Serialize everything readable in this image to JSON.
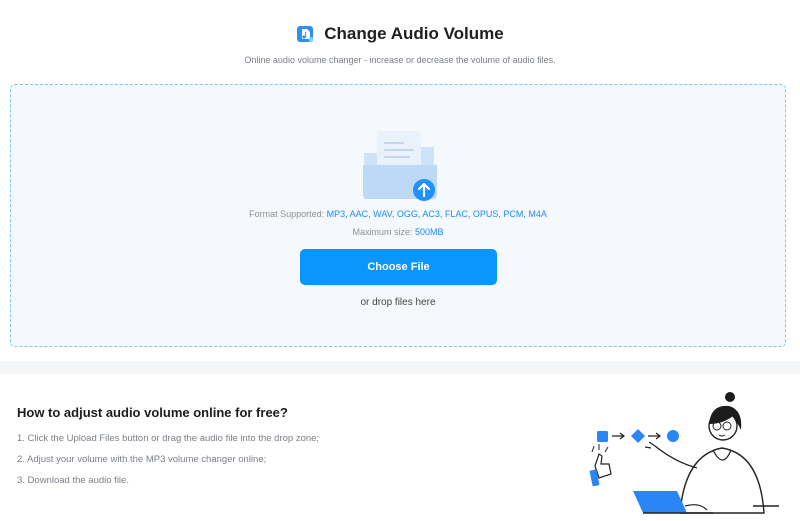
{
  "header": {
    "app_icon": "audio-file-icon",
    "title": "Change Audio Volume",
    "subtitle": "Online audio volume changer - increase or decrease the volume of audio files."
  },
  "upload": {
    "folder_icon": "upload-folder-icon",
    "formats_label": "Format Supported:",
    "formats_value": "MP3, AAC, WAV, OGG, AC3, FLAC, OPUS, PCM, M4A",
    "max_size_label": "Maximum size:",
    "max_size_value": "500MB",
    "choose_button": "Choose File",
    "drop_text": "or drop files here"
  },
  "howto": {
    "title": "How to adjust audio volume online for free?",
    "steps": [
      "1. Click the Upload Files button or drag the audio file into the drop zone;",
      "2. Adjust your volume with the MP3 volume changer online;",
      "3. Download the audio file."
    ],
    "illustration": "person-with-laptop-illustration"
  },
  "colors": {
    "accent": "#0a95ff",
    "dropzone_border": "#7cc6f6",
    "dropzone_bg": "#f5f9fd"
  }
}
